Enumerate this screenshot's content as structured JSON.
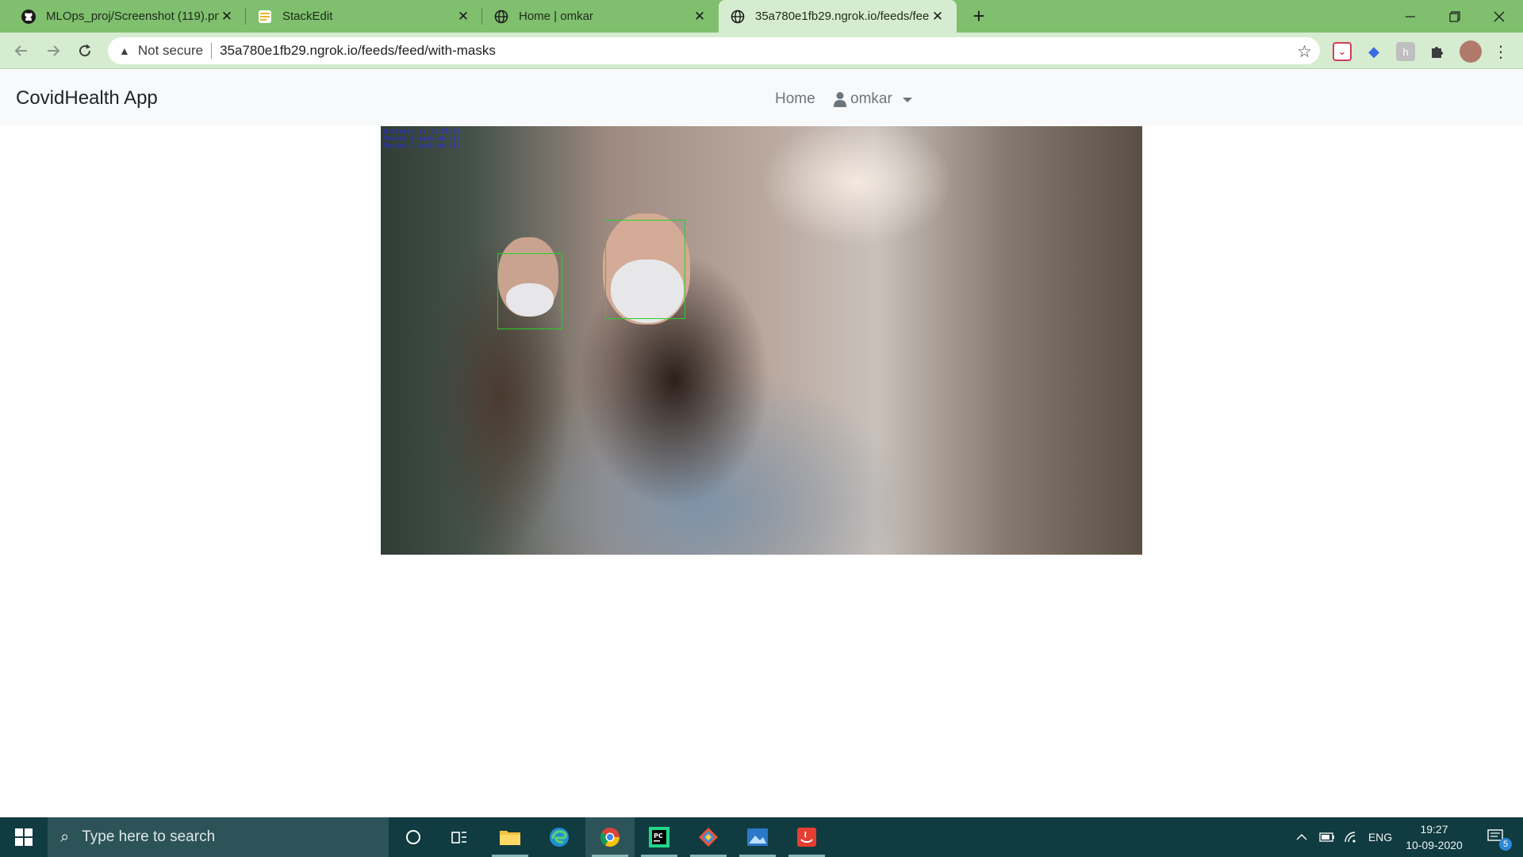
{
  "browser": {
    "tabs": [
      {
        "title": "MLOps_proj/Screenshot (119).pn",
        "icon": "github-icon"
      },
      {
        "title": "StackEdit",
        "icon": "stackedit-icon"
      },
      {
        "title": "Home | omkar",
        "icon": "globe-icon"
      },
      {
        "title": "35a780e1fb29.ngrok.io/feeds/fee",
        "icon": "globe-icon"
      }
    ],
    "security_label": "Not secure",
    "url": "35a780e1fb29.ngrok.io/feeds/feed/with-masks"
  },
  "page": {
    "brand": "CovidHealth App",
    "nav_home": "Home",
    "nav_user": "omkar",
    "feed": {
      "overlay_line1": "distance is 11.01201",
      "overlay_line2": "Person 1 mask on (1)",
      "overlay_line3": "Person 2 mask on (1)"
    }
  },
  "taskbar": {
    "search_placeholder": "Type here to search",
    "language": "ENG",
    "time": "19:27",
    "date": "10-09-2020",
    "notification_count": "5"
  },
  "colors": {
    "tabstrip": "#7fbf6e",
    "toolbar": "#d6ecd0",
    "taskbar": "#103b40",
    "bbox": "#27d127"
  }
}
